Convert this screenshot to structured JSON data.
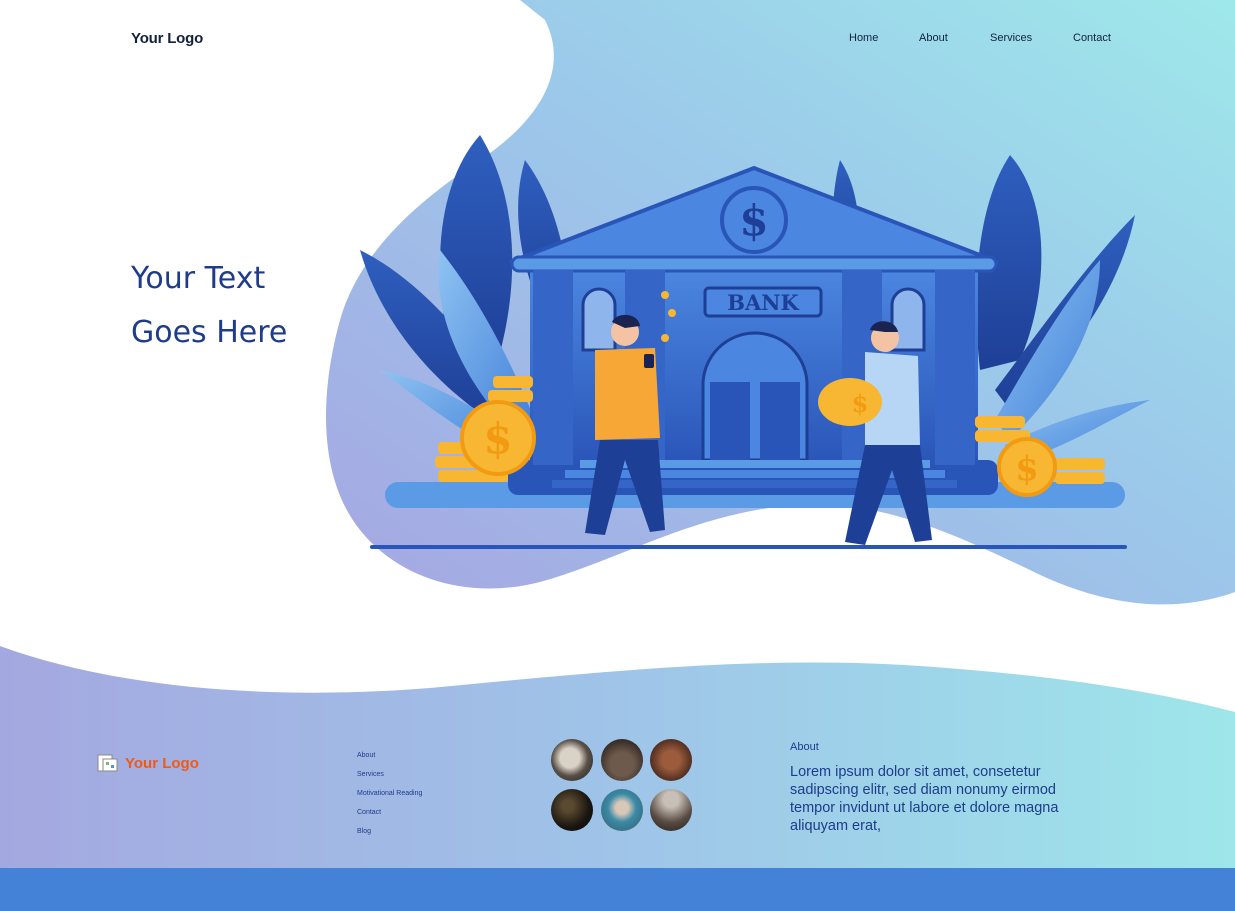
{
  "header": {
    "logo": "Your Logo",
    "nav": [
      {
        "label": "Home"
      },
      {
        "label": "About"
      },
      {
        "label": "Services"
      },
      {
        "label": "Contact"
      }
    ]
  },
  "hero": {
    "line1": "Your Text",
    "line2": "Goes Here",
    "illustration": {
      "sign": "BANK",
      "currency_symbol": "$"
    }
  },
  "footer": {
    "logo": "Your Logo",
    "links": [
      {
        "label": "About"
      },
      {
        "label": "Services"
      },
      {
        "label": "Motivational Reading"
      },
      {
        "label": "Contact"
      },
      {
        "label": "Blog"
      }
    ],
    "about": {
      "title": "About",
      "body": "Lorem ipsum dolor sit amet, consetetur sadipscing elitr, sed diam nonumy eirmod tempor invidunt ut labore et dolore magna aliquyam erat,"
    }
  },
  "colors": {
    "accent": "#1e3c8a",
    "logo_orange": "#f05a16",
    "bottom_bar": "#4382d7",
    "gradient_start": "#a3a9e0",
    "gradient_end": "#9ee6ea"
  }
}
